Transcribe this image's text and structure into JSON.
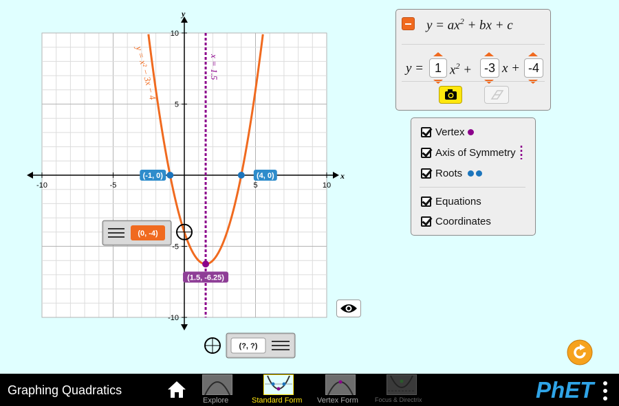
{
  "graph": {
    "x_range": [
      -10,
      10
    ],
    "y_range": [
      -10,
      10
    ],
    "axis_x_label": "x",
    "axis_y_label": "y",
    "x_tick_labels": [
      "-10",
      "-5",
      "5",
      "10"
    ],
    "y_tick_labels": [
      "10",
      "5",
      "-5",
      "-10"
    ],
    "x_tick_values": [
      -10,
      -5,
      5,
      10
    ],
    "y_tick_values": [
      10,
      5,
      -5,
      -10
    ],
    "coefficients": {
      "a": 1,
      "b": -3,
      "c": -4
    },
    "curve_equation_label": "y = x² − 3x − 4",
    "axis_of_symmetry_x": 1.5,
    "axis_of_symmetry_label": "x = 1.5",
    "vertex": {
      "x": 1.5,
      "y": -6.25,
      "label": "(1.5, -6.25)"
    },
    "roots": [
      {
        "x": -1,
        "y": 0,
        "label": "(-1, 0)"
      },
      {
        "x": 4,
        "y": 0,
        "label": "(4, 0)"
      }
    ],
    "point_tool_1": {
      "x": 0,
      "y": -4,
      "label": "(0, -4)"
    },
    "point_tool_2": {
      "label": "(?, ?)"
    }
  },
  "colors": {
    "background": "#E0FFFF",
    "curve": "#F06A1F",
    "vertex": "#8B008B",
    "roots": "#1C75BC",
    "vertex_label_bg": "#8E3E96",
    "root_label_bg": "#2E8CCB",
    "point_tool_bg": "#F06A1F"
  },
  "equation_panel": {
    "general_form": "y = ax² + bx + c",
    "y_equals": "y =",
    "a_value": "1",
    "x_squared": "x² +",
    "b_value": "-3",
    "x_plus": "x +",
    "c_value": "-4"
  },
  "checkboxes": [
    {
      "label": "Vertex",
      "checked": true
    },
    {
      "label": "Axis of Symmetry",
      "checked": true
    },
    {
      "label": "Roots",
      "checked": true
    },
    {
      "label": "Equations",
      "checked": true
    },
    {
      "label": "Coordinates",
      "checked": true
    }
  ],
  "navbar": {
    "sim_title": "Graphing Quadratics",
    "screens": [
      {
        "label": "Explore",
        "selected": false
      },
      {
        "label": "Standard Form",
        "selected": true
      },
      {
        "label": "Vertex Form",
        "selected": false
      },
      {
        "label": "Focus & Directrix",
        "selected": false
      }
    ],
    "logo_text": "PhET"
  }
}
